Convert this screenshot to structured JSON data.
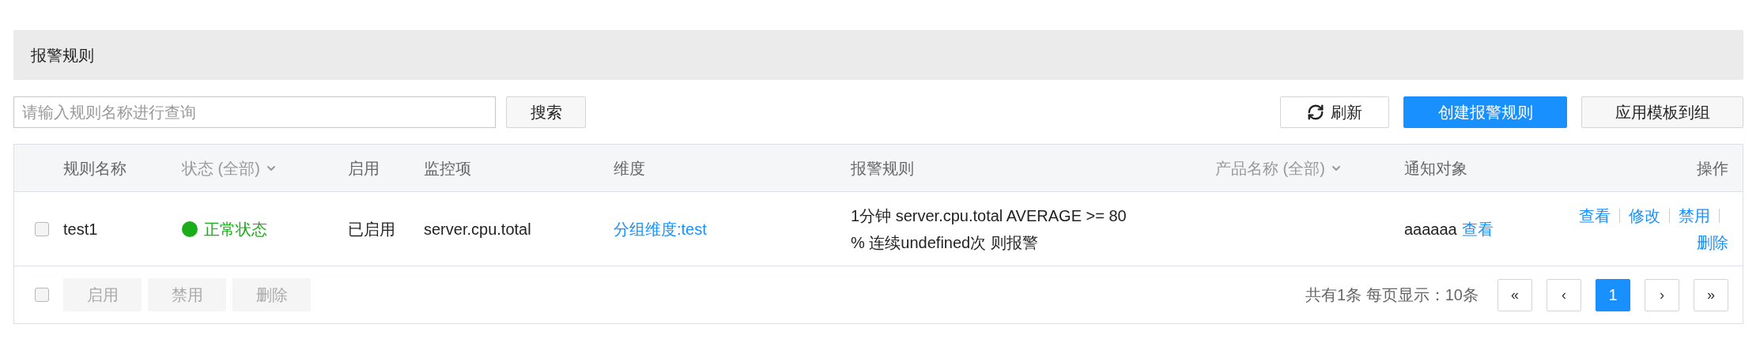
{
  "header": {
    "title": "报警规则"
  },
  "search": {
    "placeholder": "请输入规则名称进行查询",
    "button": "搜索"
  },
  "toolbar": [
    {
      "kind": "refresh",
      "label": "刷新"
    },
    {
      "kind": "primary",
      "label": "创建报警规则"
    },
    {
      "kind": "default",
      "label": "应用模板到组"
    }
  ],
  "table": {
    "columns": [
      {
        "label": "规则名称",
        "dropdown": false
      },
      {
        "label": "状态 (全部)",
        "dropdown": true
      },
      {
        "label": "启用",
        "dropdown": false
      },
      {
        "label": "监控项",
        "dropdown": false
      },
      {
        "label": "维度",
        "dropdown": false
      },
      {
        "label": "报警规则",
        "dropdown": false
      },
      {
        "label": "产品名称 (全部)",
        "dropdown": true
      },
      {
        "label": "通知对象",
        "dropdown": false
      },
      {
        "label": "操作",
        "dropdown": false
      }
    ],
    "rows": [
      {
        "checked": false,
        "name": "test1",
        "status": {
          "text": "正常状态",
          "color": "#1aad19"
        },
        "enabled": "已启用",
        "metric": "server.cpu.total",
        "dimension": "分组维度:test",
        "rule": "1分钟 server.cpu.total AVERAGE >= 80 % 连续undefined次 则报警",
        "product": "",
        "notify": "aaaaaa",
        "notify_link": "查看",
        "actions": [
          "查看",
          "修改",
          "禁用",
          "删除"
        ]
      }
    ]
  },
  "footer": {
    "checked": false,
    "bulk_buttons": [
      {
        "label": "启用",
        "disabled": true
      },
      {
        "label": "禁用",
        "disabled": true
      },
      {
        "label": "删除",
        "disabled": true
      }
    ],
    "summary": "共有1条 每页显示：10条",
    "pagination": [
      {
        "label": "«",
        "selected": false
      },
      {
        "label": "‹",
        "selected": false
      },
      {
        "label": "1",
        "selected": true
      },
      {
        "label": "›",
        "selected": false
      },
      {
        "label": "»",
        "selected": false
      }
    ]
  }
}
